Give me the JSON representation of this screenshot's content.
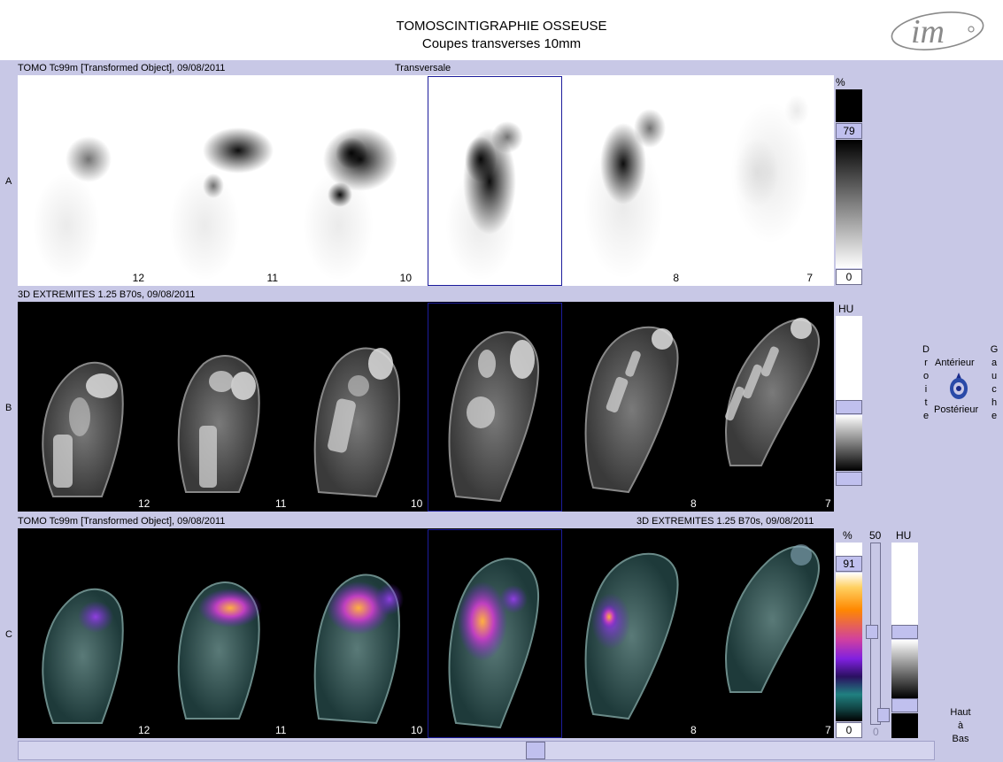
{
  "title": {
    "line1": "TOMOSCINTIGRAPHIE OSSEUSE",
    "line2": "Coupes transverses 10mm",
    "logo_text": "im"
  },
  "row_a": {
    "label": "A",
    "header_left": "TOMO Tc99m [Transformed Object], 09/08/2011",
    "header_center": "Transversale",
    "slices": [
      "12",
      "11",
      "10",
      "",
      "8",
      "7"
    ],
    "scale": {
      "unit": "%",
      "max": "79",
      "min": "0"
    }
  },
  "row_b": {
    "label": "B",
    "header_left": "3D EXTREMITES  1.25  B70s, 09/08/2011",
    "slices": [
      "12",
      "11",
      "10",
      "",
      "8",
      "7"
    ],
    "scale": {
      "unit": "HU"
    }
  },
  "row_c": {
    "label": "C",
    "header_left": "TOMO Tc99m [Transformed Object], 09/08/2011",
    "header_right": "3D EXTREMITES  1.25  B70s, 09/08/2011",
    "slices": [
      "12",
      "11",
      "10",
      "",
      "8",
      "7"
    ],
    "scale": {
      "unit_pct": "%",
      "max": "91",
      "min": "0",
      "blend": "50",
      "blend_min": "0",
      "unit_hu": "HU"
    }
  },
  "orientation": {
    "left": [
      "D",
      "r",
      "o",
      "i",
      "t",
      "e"
    ],
    "right": [
      "G",
      "a",
      "u",
      "c",
      "h",
      "e"
    ],
    "top": "Antérieur",
    "bottom": "Postérieur"
  },
  "direction": {
    "line1": "Haut",
    "line2": "à",
    "line3": "Bas"
  },
  "colors": {
    "background": "#c8c8e6",
    "selection": "#1c1c9c",
    "accent_box": "#c0c0ee"
  }
}
